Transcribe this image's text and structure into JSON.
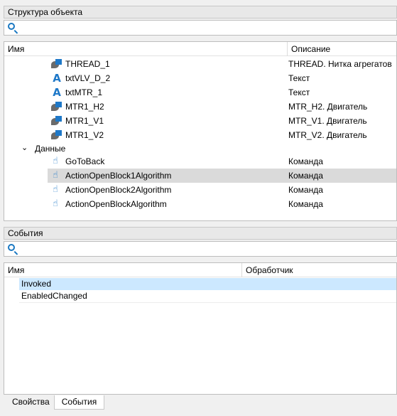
{
  "structure": {
    "title": "Структура объекта",
    "columns": [
      "Имя",
      "Описание"
    ],
    "items": [
      {
        "name": "THREAD_1",
        "desc": "THREAD. Нитка агрегатов",
        "icon": "object-icon"
      },
      {
        "name": "txtVLV_D_2",
        "desc": "Текст",
        "icon": "text-icon"
      },
      {
        "name": "txtMTR_1",
        "desc": "Текст",
        "icon": "text-icon"
      },
      {
        "name": "MTR1_H2",
        "desc": "MTR_H2. Двигатель",
        "icon": "object-icon"
      },
      {
        "name": "MTR1_V1",
        "desc": "MTR_V1. Двигатель",
        "icon": "object-icon"
      },
      {
        "name": "MTR1_V2",
        "desc": "MTR_V2. Двигатель",
        "icon": "object-icon"
      }
    ],
    "group": {
      "label": "Данные",
      "expanded": true
    },
    "group_items": [
      {
        "name": "GoToBack",
        "desc": "Команда",
        "icon": "hand-pointer-icon"
      },
      {
        "name": "ActionOpenBlock1Algorithm",
        "desc": "Команда",
        "icon": "hand-pointer-icon",
        "selected": true
      },
      {
        "name": "ActionOpenBlock2Algorithm",
        "desc": "Команда",
        "icon": "hand-pointer-icon"
      },
      {
        "name": "ActionOpenBlockAlgorithm",
        "desc": "Команда",
        "icon": "hand-pointer-icon"
      }
    ]
  },
  "events": {
    "title": "События",
    "columns": [
      "Имя",
      "Обработчик"
    ],
    "items": [
      {
        "name": "Invoked",
        "selected": true
      },
      {
        "name": "EnabledChanged"
      }
    ]
  },
  "tabs": [
    {
      "label": "Свойства",
      "active": false
    },
    {
      "label": "События",
      "active": true
    }
  ],
  "colors": {
    "accent": "#1e78c8",
    "selection_grey": "#dadada",
    "selection_blue": "#cce8ff"
  }
}
